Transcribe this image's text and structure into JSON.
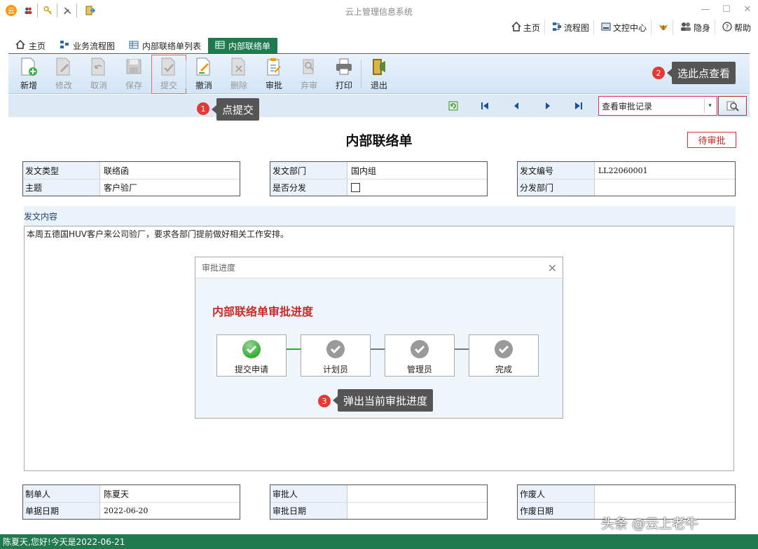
{
  "window": {
    "title": "云上管理信息系统",
    "controls": [
      "—",
      "☐",
      "✕"
    ]
  },
  "topnav": [
    {
      "label": "主页",
      "icon": "home-icon"
    },
    {
      "label": "流程图",
      "icon": "flowchart-icon"
    },
    {
      "label": "文控中心",
      "icon": "document-center-icon"
    },
    {
      "label": "",
      "icon": "leaf-icon"
    },
    {
      "label": "隐身",
      "icon": "invisible-icon"
    },
    {
      "label": "帮助",
      "icon": "help-icon"
    }
  ],
  "tabs": [
    {
      "label": "主页",
      "icon": "home-icon",
      "active": false
    },
    {
      "label": "业务流程图",
      "icon": "flowchart-icon",
      "active": false
    },
    {
      "label": "内部联络单列表",
      "icon": "table-icon",
      "active": false
    },
    {
      "label": "内部联络单",
      "icon": "table-icon",
      "active": true
    }
  ],
  "toolbar": {
    "new": "新增",
    "edit": "修改",
    "cancel": "取消",
    "save": "保存",
    "submit": "提交",
    "withdraw": "撤消",
    "delete": "删除",
    "approve": "审批",
    "abandon": "弃审",
    "print": "打印",
    "exit": "退出"
  },
  "recordNav": {
    "selectValue": "查看审批记录"
  },
  "callouts": {
    "c1": {
      "num": "1",
      "text": "点提交"
    },
    "c2": {
      "num": "2",
      "text": "选此点查看"
    },
    "c3": {
      "num": "3",
      "text": "弹出当前审批进度"
    }
  },
  "form": {
    "title": "内部联络单",
    "status": "待审批",
    "fields": {
      "docTypeLabel": "发文类型",
      "docType": "联络函",
      "subjectLabel": "主题",
      "subject": "客户验厂",
      "deptLabel": "发文部门",
      "dept": "国内组",
      "distributeLabel": "是否分发",
      "docNoLabel": "发文编号",
      "docNo": "LL22060001",
      "distDeptLabel": "分发部门",
      "distDept": ""
    },
    "contentLabel": "发文内容",
    "content": "本周五德国HUV客户来公司验厂，要求各部门提前做好相关工作安排。",
    "footer": {
      "creatorLabel": "制单人",
      "creator": "陈夏天",
      "dateLabel": "单据日期",
      "date": "2022-06-20",
      "approverLabel": "审批人",
      "approver": "",
      "approveDateLabel": "审批日期",
      "approveDate": "",
      "voidByLabel": "作废人",
      "voidBy": "",
      "voidDateLabel": "作废日期",
      "voidDate": ""
    }
  },
  "modal": {
    "header": "审批进度",
    "title": "内部联络单审批进度",
    "steps": [
      {
        "label": "提交申请",
        "done": true
      },
      {
        "label": "计划员",
        "done": false
      },
      {
        "label": "管理员",
        "done": false
      },
      {
        "label": "完成",
        "done": false
      }
    ]
  },
  "watermark": "头条 @云上老牛",
  "statusbar": "陈夏天,您好!今天是2022-06-21",
  "colors": {
    "accent": "#1f7a4f",
    "alert": "#e53935",
    "stepDone": "#2eaa2e",
    "stepPending": "#999999"
  }
}
